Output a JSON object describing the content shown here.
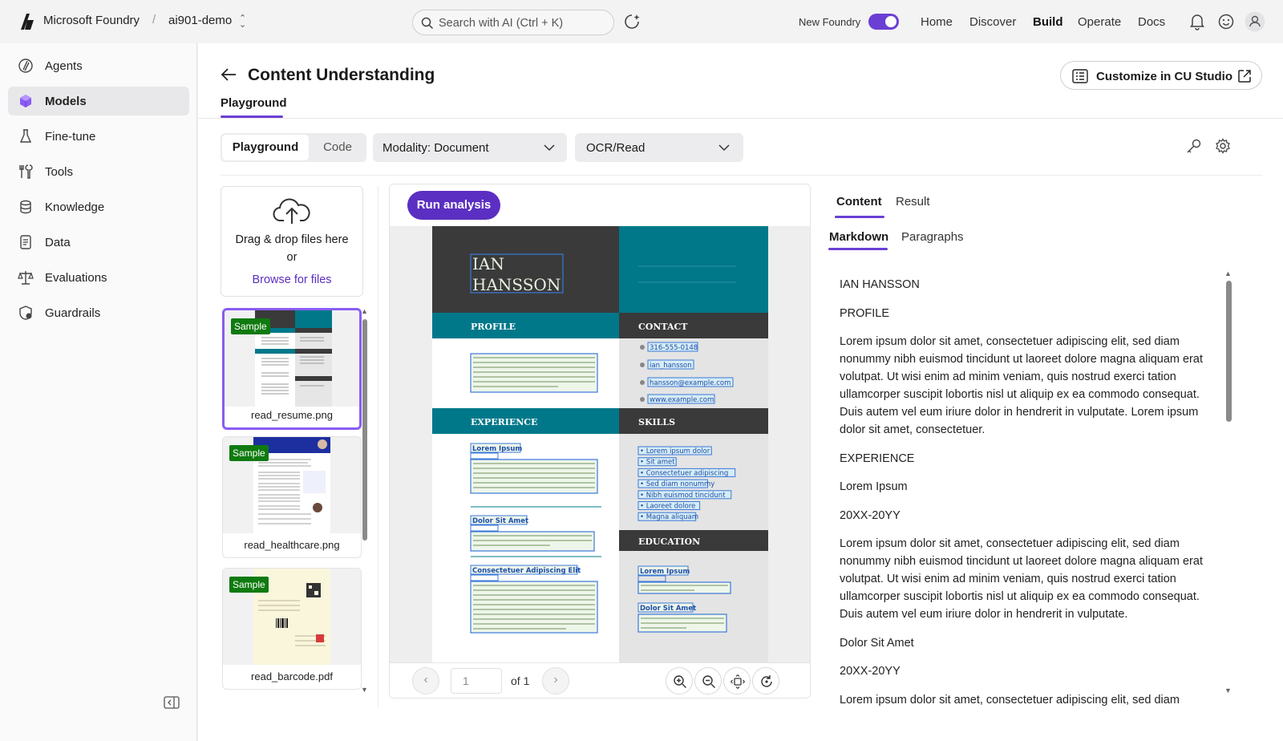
{
  "topbar": {
    "brand": "Microsoft Foundry",
    "separator": "/",
    "project": "ai901-demo",
    "search_placeholder": "Search with AI (Ctrl + K)",
    "new_foundry_label": "New Foundry",
    "new_foundry_on": true,
    "nav": [
      "Home",
      "Discover",
      "Build",
      "Operate",
      "Docs"
    ],
    "active_nav": "Build"
  },
  "sidebar": {
    "items": [
      {
        "label": "Agents",
        "icon": "agents-icon"
      },
      {
        "label": "Models",
        "icon": "models-icon",
        "active": true
      },
      {
        "label": "Fine-tune",
        "icon": "flask-icon"
      },
      {
        "label": "Tools",
        "icon": "tools-icon"
      },
      {
        "label": "Knowledge",
        "icon": "database-icon"
      },
      {
        "label": "Data",
        "icon": "document-icon"
      },
      {
        "label": "Evaluations",
        "icon": "scale-icon"
      },
      {
        "label": "Guardrails",
        "icon": "shield-icon"
      }
    ]
  },
  "page": {
    "title": "Content Understanding",
    "customize_label": "Customize in CU Studio",
    "tab": "Playground"
  },
  "toolbar": {
    "seg_playground": "Playground",
    "seg_code": "Code",
    "modality": "Modality:  Document",
    "analyzer": "OCR/Read"
  },
  "upload": {
    "line1": "Drag & drop files here",
    "line2": "or",
    "browse": "Browse for files"
  },
  "files": [
    {
      "name": "read_resume.png",
      "badge": "Sample",
      "selected": true
    },
    {
      "name": "read_healthcare.png",
      "badge": "Sample"
    },
    {
      "name": "read_barcode.pdf",
      "badge": "Sample"
    }
  ],
  "viewer": {
    "run_label": "Run analysis",
    "page_value": "1",
    "page_of": "of 1",
    "resume": {
      "name_line1": "IAN",
      "name_line2": "HANSSON",
      "profile": "PROFILE",
      "contact": "CONTACT",
      "experience": "EXPERIENCE",
      "skills": "SKILLS",
      "education": "EDUCATION",
      "phone": "316-555-0148",
      "handle": "ian_hansson",
      "email": "hansson@example.com",
      "web": "www.example.com",
      "job1": "Lorem Ipsum",
      "job2": "Dolor Sit Amet",
      "job3": "Consectetuer Adipiscing Elit",
      "edu1": "Lorem Ipsum",
      "edu2": "Dolor Sit Amet",
      "skill_items": [
        "Lorem ipsum dolor",
        "Sit amet",
        "Consectetuer adipiscing",
        "Sed diam nonummy",
        "Nibh euismod tincidunt",
        "Laoreet dolore",
        "Magna aliquam"
      ]
    }
  },
  "results": {
    "tabs": [
      "Content",
      "Result"
    ],
    "subtabs": [
      "Markdown",
      "Paragraphs"
    ],
    "paragraphs": [
      "IAN HANSSON",
      "PROFILE",
      "Lorem ipsum dolor sit amet, consectetuer adipiscing elit, sed diam nonummy nibh euismod tincidunt ut laoreet dolore magna aliquam erat volutpat. Ut wisi enim ad minim veniam, quis nostrud exerci tation ullamcorper suscipit lobortis nisl ut aliquip ex ea commodo consequat. Duis autem vel eum iriure dolor in hendrerit in vulputate. Lorem ipsum dolor sit amet, consectetuer.",
      "EXPERIENCE",
      "Lorem Ipsum",
      "20XX-20YY",
      "Lorem ipsum dolor sit amet, consectetuer adipiscing elit, sed diam nonummy nibh euismod tincidunt ut laoreet dolore magna aliquam erat volutpat. Ut wisi enim ad minim veniam, quis nostrud exerci tation ullamcorper suscipit lobortis nisl ut aliquip ex ea commodo consequat. Duis autem vel eum iriure dolor in hendrerit in vulputate.",
      "Dolor Sit Amet",
      "20XX-20YY",
      "Lorem ipsum dolor sit amet, consectetuer adipiscing elit, sed diam"
    ]
  },
  "colors": {
    "accent": "#6b3fd4",
    "run_button": "#5b2fc1",
    "sample_badge": "#0f7a0f",
    "resume_dark": "#3a3a3a",
    "resume_teal": "#00788a"
  }
}
